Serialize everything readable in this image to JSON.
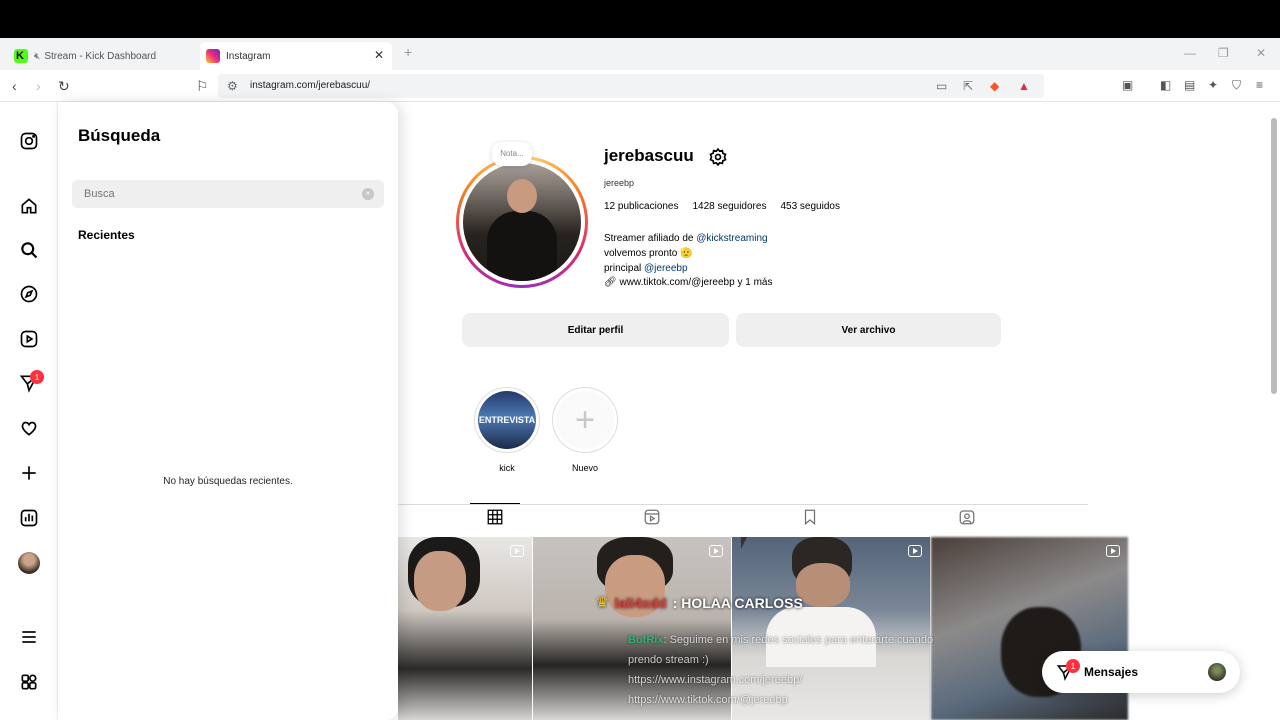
{
  "browser": {
    "tabs": [
      {
        "title": "Stream - Kick Dashboard",
        "icon": "kick-icon",
        "muted": true
      },
      {
        "title": "Instagram",
        "icon": "instagram-icon",
        "active": true
      }
    ],
    "url": "instagram.com/jerebascuu/"
  },
  "nav": {
    "notifications_badge": "1"
  },
  "search": {
    "title": "Búsqueda",
    "placeholder": "Busca",
    "clear": "×",
    "recent_label": "Recientes",
    "empty_text": "No hay búsquedas recientes."
  },
  "profile": {
    "note": "Nota...",
    "username": "jerebascuu",
    "handle": "jereebp",
    "stats": {
      "posts": "12 publicaciones",
      "followers": "1428 seguidores",
      "following": "453 seguidos"
    },
    "bio": {
      "line1_prefix": "Streamer afiliado de ",
      "line1_link": "@kickstreaming",
      "line2": "volvemos pronto 🫡",
      "line3_prefix": "principal ",
      "line3_link": "@jereebp",
      "link": "www.tiktok.com/@jereebp y 1 más"
    },
    "buttons": {
      "edit": "Editar perfil",
      "archive": "Ver archivo"
    },
    "highlights": [
      {
        "label": "kick"
      },
      {
        "label": "Nuevo",
        "plus": "+"
      }
    ]
  },
  "chat": {
    "user": "lali4xdd",
    "message": ": HOLAA CARLOSS",
    "bot_name": "BotRix",
    "bot_text": ": Seguime en mis redes sociales para enterarte cuando prendo stream :)",
    "bot_link1": "https://www.instagram.com/jereebp/",
    "bot_link2": "https://www.tiktok.com/@jereebp"
  },
  "messages_pill": {
    "label": "Mensajes",
    "badge": "1"
  },
  "colors": {
    "accent_link": "#00376b",
    "badge": "#ff3040",
    "button_bg": "#efefef"
  }
}
